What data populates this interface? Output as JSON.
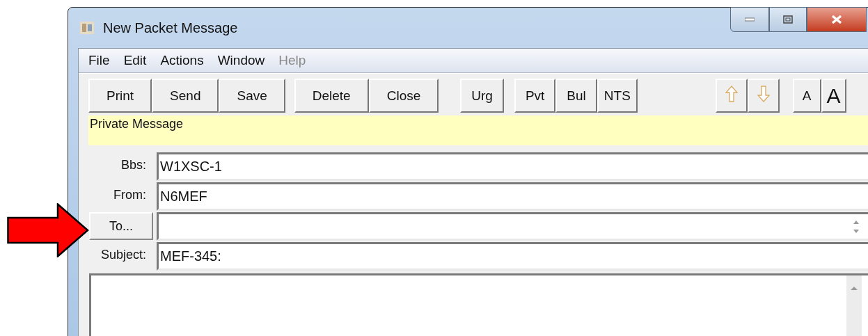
{
  "window": {
    "title": "New Packet Message"
  },
  "menu": [
    {
      "label": "File",
      "disabled": false
    },
    {
      "label": "Edit",
      "disabled": false
    },
    {
      "label": "Actions",
      "disabled": false
    },
    {
      "label": "Window",
      "disabled": false
    },
    {
      "label": "Help",
      "disabled": true
    }
  ],
  "toolbar": [
    [
      {
        "kind": "text",
        "label": "Print"
      },
      {
        "kind": "text",
        "label": "Send"
      },
      {
        "kind": "text",
        "label": "Save"
      }
    ],
    [
      {
        "kind": "text",
        "label": "Delete"
      },
      {
        "kind": "text",
        "label": "Close"
      }
    ],
    [
      {
        "kind": "text",
        "label": "Urg"
      }
    ],
    [
      {
        "kind": "text",
        "label": "Pvt"
      },
      {
        "kind": "text",
        "label": "Bul"
      },
      {
        "kind": "text",
        "label": "NTS"
      }
    ],
    [
      {
        "kind": "up"
      },
      {
        "kind": "down"
      }
    ],
    [
      {
        "kind": "text",
        "label": "A"
      },
      {
        "kind": "big",
        "label": "A"
      }
    ]
  ],
  "banner": "Private Message",
  "fields": [
    {
      "kind": "label",
      "label": "Bbs:",
      "value": "W1XSC-1"
    },
    {
      "kind": "label",
      "label": "From:",
      "value": "N6MEF"
    },
    {
      "kind": "button",
      "label": "To..."
    },
    {
      "kind": "label",
      "label": "Subject:",
      "value": "MEF-345:"
    }
  ]
}
